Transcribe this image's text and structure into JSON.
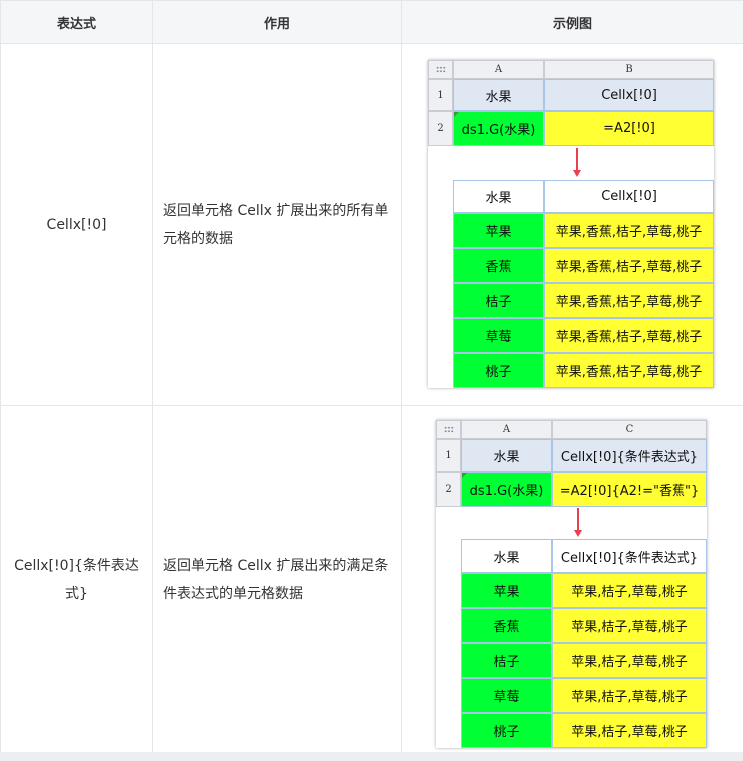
{
  "table": {
    "headers": {
      "expression": "表达式",
      "function": "作用",
      "example": "示例图"
    },
    "rows": [
      {
        "expression": "Cellx[!0]",
        "function": "返回单元格 Cellx 扩展出来的所有单元格的数据",
        "example": {
          "col_letters": [
            "A",
            "B"
          ],
          "row_numbers": [
            "1",
            "2"
          ],
          "header_cells": [
            "水果",
            "Cellx[!0]"
          ],
          "formula_cells": [
            "ds1.G(水果)",
            "=A2[!0]"
          ],
          "result_header": [
            "水果",
            "Cellx[!0]"
          ],
          "result_rows": [
            [
              "苹果",
              "苹果,香蕉,桔子,草莓,桃子"
            ],
            [
              "香蕉",
              "苹果,香蕉,桔子,草莓,桃子"
            ],
            [
              "桔子",
              "苹果,香蕉,桔子,草莓,桃子"
            ],
            [
              "草莓",
              "苹果,香蕉,桔子,草莓,桃子"
            ],
            [
              "桃子",
              "苹果,香蕉,桔子,草莓,桃子"
            ]
          ]
        }
      },
      {
        "expression": "Cellx[!0]{条件表达式}",
        "function": "返回单元格 Cellx 扩展出来的满足条件表达式的单元格数据",
        "example": {
          "col_letters": [
            "A",
            "C"
          ],
          "row_numbers": [
            "1",
            "2"
          ],
          "header_cells": [
            "水果",
            "Cellx[!0]{条件表达式}"
          ],
          "formula_cells": [
            "ds1.G(水果)",
            "=A2[!0]{A2!=\"香蕉\"}"
          ],
          "result_header": [
            "水果",
            "Cellx[!0]{条件表达式}"
          ],
          "result_rows": [
            [
              "苹果",
              "苹果,桔子,草莓,桃子"
            ],
            [
              "香蕉",
              "苹果,桔子,草莓,桃子"
            ],
            [
              "桔子",
              "苹果,桔子,草莓,桃子"
            ],
            [
              "草莓",
              "苹果,桔子,草莓,桃子"
            ],
            [
              "桃子",
              "苹果,桔子,草莓,桃子"
            ]
          ]
        }
      }
    ]
  },
  "colors": {
    "green": "#00ff33",
    "yellow": "#ffff33",
    "arrow": "#e8414d"
  }
}
